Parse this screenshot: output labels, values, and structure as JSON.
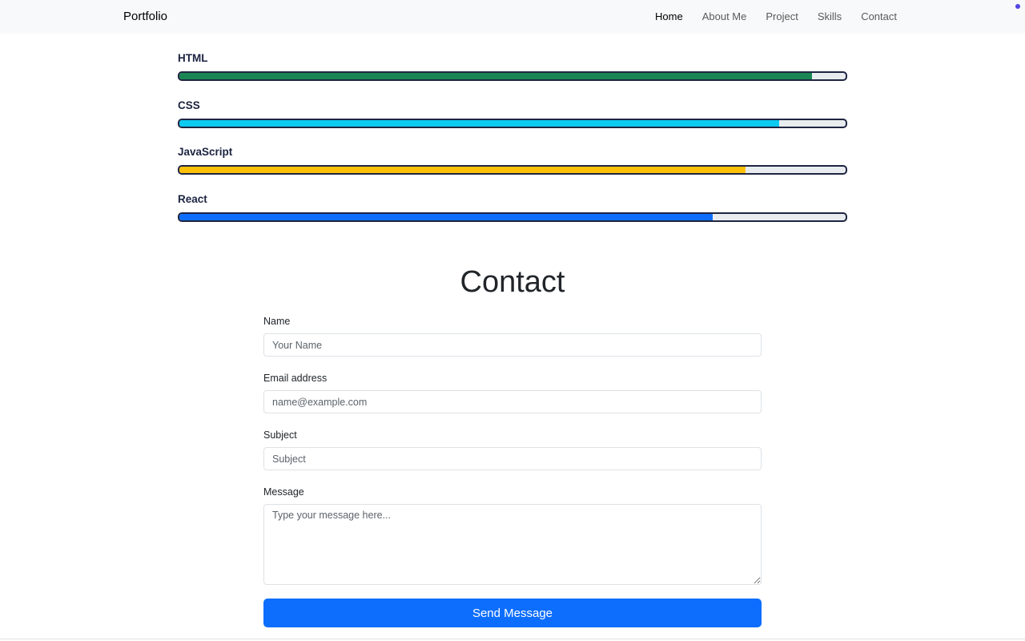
{
  "nav": {
    "brand": "Portfolio",
    "links": [
      "Home",
      "About Me",
      "Project",
      "Skills",
      "Contact"
    ],
    "active": "Home"
  },
  "skills": [
    {
      "name": "HTML",
      "level": 0.95,
      "color": "#198754"
    },
    {
      "name": "CSS",
      "level": 0.9,
      "color": "#0dcaf0"
    },
    {
      "name": "JavaScript",
      "level": 0.85,
      "color": "#ffc107"
    },
    {
      "name": "React",
      "level": 0.8,
      "color": "#0d6efd"
    }
  ],
  "contact": {
    "title": "Contact",
    "name_label": "Name",
    "name_placeholder": "Your Name",
    "email_label": "Email address",
    "email_placeholder": "name@example.com",
    "subject_label": "Subject",
    "subject_placeholder": "Subject",
    "message_label": "Message",
    "message_placeholder": "Type your message here...",
    "submit_label": "Send Message"
  }
}
